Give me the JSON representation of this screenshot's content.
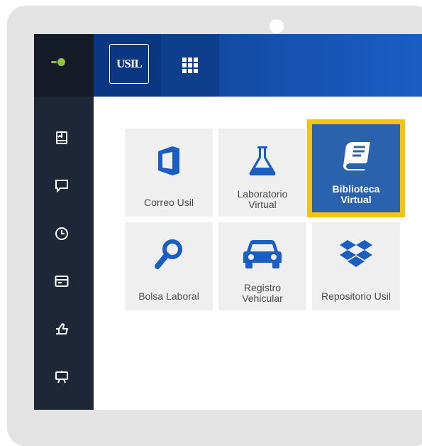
{
  "colors": {
    "accent": "#1a5ec4",
    "highlight": "#f4c311",
    "icon_blue": "#1a5ec4",
    "active_tile": "#2a62ad",
    "sidebar": "#1e2738"
  },
  "header": {
    "logo_text": "USIL",
    "apps_icon": "app-grid-icon"
  },
  "sidebar": {
    "toggle_icon": "status-toggle-icon",
    "items": [
      {
        "icon": "book-icon"
      },
      {
        "icon": "chat-icon"
      },
      {
        "icon": "clock-icon"
      },
      {
        "icon": "card-icon"
      },
      {
        "icon": "thumbs-up-icon"
      },
      {
        "icon": "presentation-icon"
      }
    ]
  },
  "apps": {
    "tiles": [
      {
        "label": "Correo Usil",
        "icon": "office-icon"
      },
      {
        "label": "Laboratorio\nVirtual",
        "icon": "flask-icon"
      },
      {
        "label": "Biblioteca\nVirtual",
        "icon": "book-icon",
        "selected": true
      },
      {
        "label": "Bolsa Laboral",
        "icon": "search-icon"
      },
      {
        "label": "Registro\nVehicular",
        "icon": "car-icon"
      },
      {
        "label": "Repositorio Usil",
        "icon": "dropbox-icon"
      }
    ]
  }
}
